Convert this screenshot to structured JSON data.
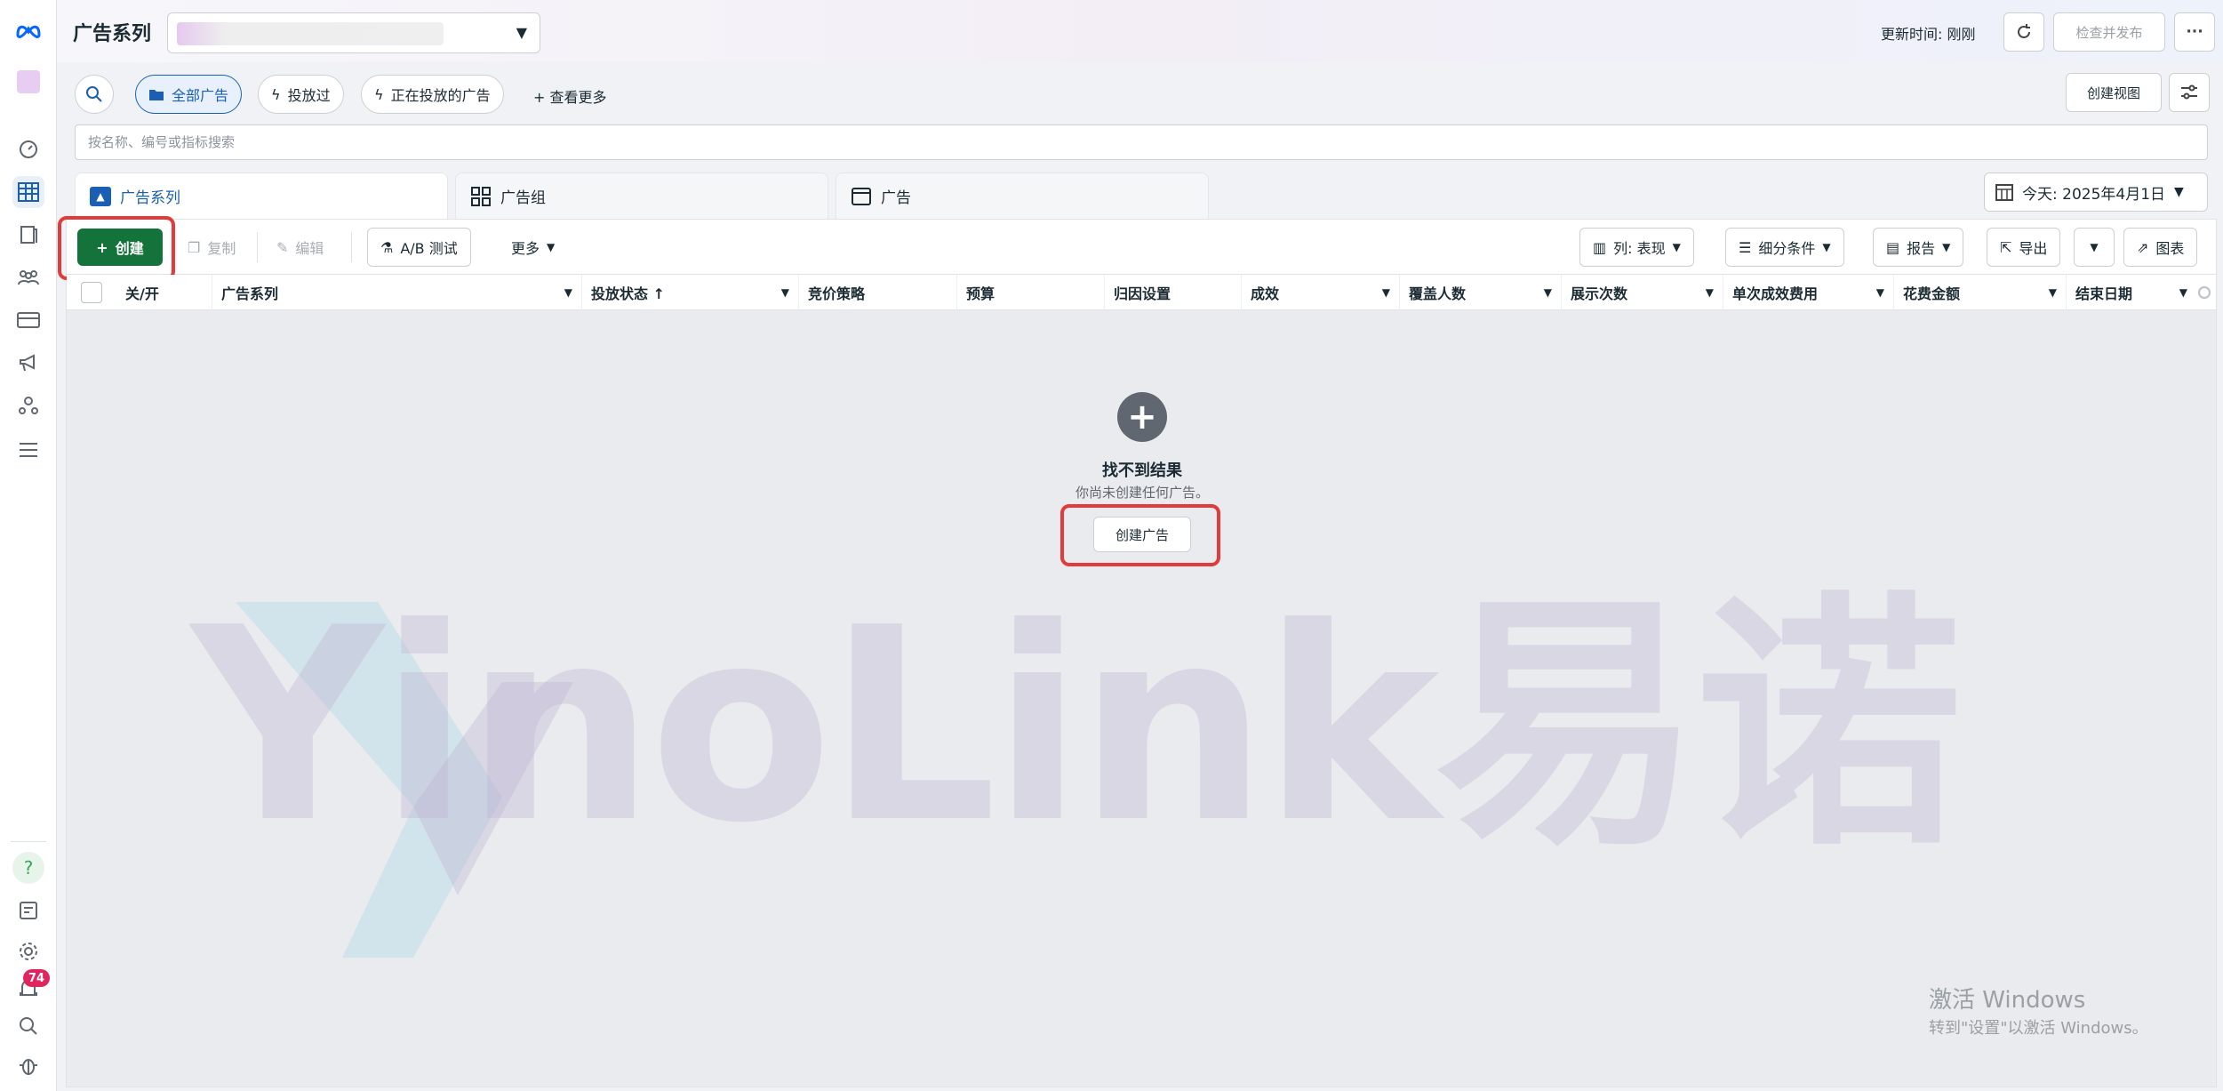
{
  "header": {
    "title": "广告系列",
    "update_time": "更新时间: 刚刚",
    "publish_button": "检查并发布",
    "more_button": "···"
  },
  "filters": {
    "pills": [
      {
        "label": "全部广告",
        "icon": "folder-icon",
        "selected": true
      },
      {
        "label": "投放过",
        "icon": "lightning-icon",
        "selected": false
      },
      {
        "label": "正在投放的广告",
        "icon": "lightning-icon",
        "selected": false
      }
    ],
    "see_more": "+ 查看更多",
    "create_view": "创建视图"
  },
  "search": {
    "placeholder": "按名称、编号或指标搜索"
  },
  "tabs": [
    {
      "label": "广告系列",
      "icon": "campaign-icon",
      "active": true
    },
    {
      "label": "广告组",
      "icon": "adset-icon",
      "active": false
    },
    {
      "label": "广告",
      "icon": "ad-icon",
      "active": false
    }
  ],
  "date": {
    "label": "今天: 2025年4月1日"
  },
  "toolbar": {
    "create": "创建",
    "copy": "复制",
    "edit": "编辑",
    "ab_test": "A/B 测试",
    "more": "更多",
    "columns": "列: 表现",
    "breakdown": "细分条件",
    "reports": "报告",
    "export": "导出",
    "charts": "图表"
  },
  "table": {
    "columns": [
      "关/开",
      "广告系列",
      "投放状态 ↑",
      "竞价策略",
      "预算",
      "归因设置",
      "成效",
      "覆盖人数",
      "展示次数",
      "单次成效费用",
      "花费金额",
      "结束日期"
    ]
  },
  "empty_state": {
    "title": "找不到结果",
    "subtitle": "你尚未创建任何广告。",
    "button": "创建广告"
  },
  "watermark": {
    "text": "YinoLink易诺"
  },
  "windows_activation": {
    "title": "激活 Windows",
    "subtitle": "转到\"设置\"以激活 Windows。"
  },
  "rail": {
    "notification_count": "74"
  },
  "colors": {
    "accent": "#1a5fb4",
    "create_green": "#14733a",
    "highlight_red": "#e23b3b"
  }
}
